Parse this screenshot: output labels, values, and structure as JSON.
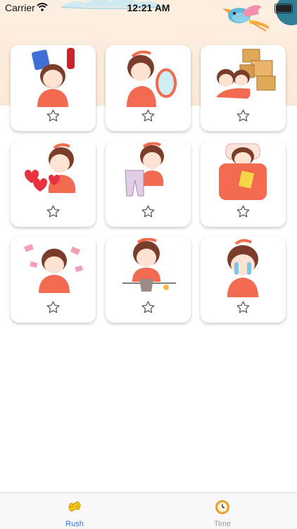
{
  "status_bar": {
    "carrier": "Carrier",
    "time": "12:21 AM",
    "battery_level": 1.0
  },
  "header": {
    "decorations": [
      "cloud",
      "bird",
      "sun"
    ]
  },
  "stickers": [
    {
      "name": "girl-with-snacks-sticker",
      "favorited": false
    },
    {
      "name": "girl-with-mirror-sticker",
      "favorited": false
    },
    {
      "name": "girls-with-boxes-sticker",
      "favorited": false
    },
    {
      "name": "girl-with-hearts-sticker",
      "favorited": false
    },
    {
      "name": "girl-with-pants-sticker",
      "favorited": false
    },
    {
      "name": "girl-sleeping-sticker",
      "favorited": false
    },
    {
      "name": "girl-with-money-sticker",
      "favorited": false
    },
    {
      "name": "girl-with-plant-sticker",
      "favorited": false
    },
    {
      "name": "girl-crying-sticker",
      "favorited": false
    }
  ],
  "tabs": [
    {
      "label": "Rush",
      "icon": "puzzle-icon",
      "active": true
    },
    {
      "label": "Time",
      "icon": "clock-icon",
      "active": false
    }
  ],
  "colors": {
    "accent": "#3478f6",
    "inactive": "#9a9a9a",
    "header": "#fcefe1",
    "sticker_main": "#f26a4f"
  }
}
